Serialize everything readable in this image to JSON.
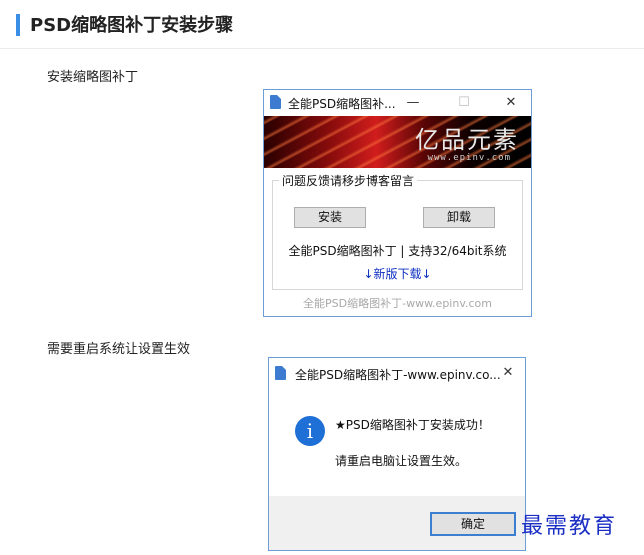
{
  "page": {
    "title": "PSD缩略图补丁安装步骤",
    "accent_color": "#3a8ee6"
  },
  "steps": [
    {
      "label": "安装缩略图补丁"
    },
    {
      "label": "需要重启系统让设置生效"
    }
  ],
  "installer_window": {
    "title": "全能PSD缩略图补...",
    "controls": {
      "minimize": "—",
      "maximize": "☐",
      "close": "✕"
    },
    "banner": {
      "logo_text": "亿品元素",
      "url_text": "www.epinv.com"
    },
    "group_title": "问题反馈请移步博客留言",
    "install_button": "安装",
    "uninstall_button": "卸载",
    "support_text": "全能PSD缩略图补丁 | 支持32/64bit系统",
    "download_link": "↓新版下载↓",
    "footer_text": "全能PSD缩略图补丁-www.epinv.com"
  },
  "message_box": {
    "title": "全能PSD缩略图补丁-www.epinv.co...",
    "close": "✕",
    "icon": "info-icon",
    "message": "★PSD缩略图补丁安装成功！",
    "submessage": "请重启电脑让设置生效。",
    "ok_button": "确定"
  },
  "watermark": "最需教育"
}
